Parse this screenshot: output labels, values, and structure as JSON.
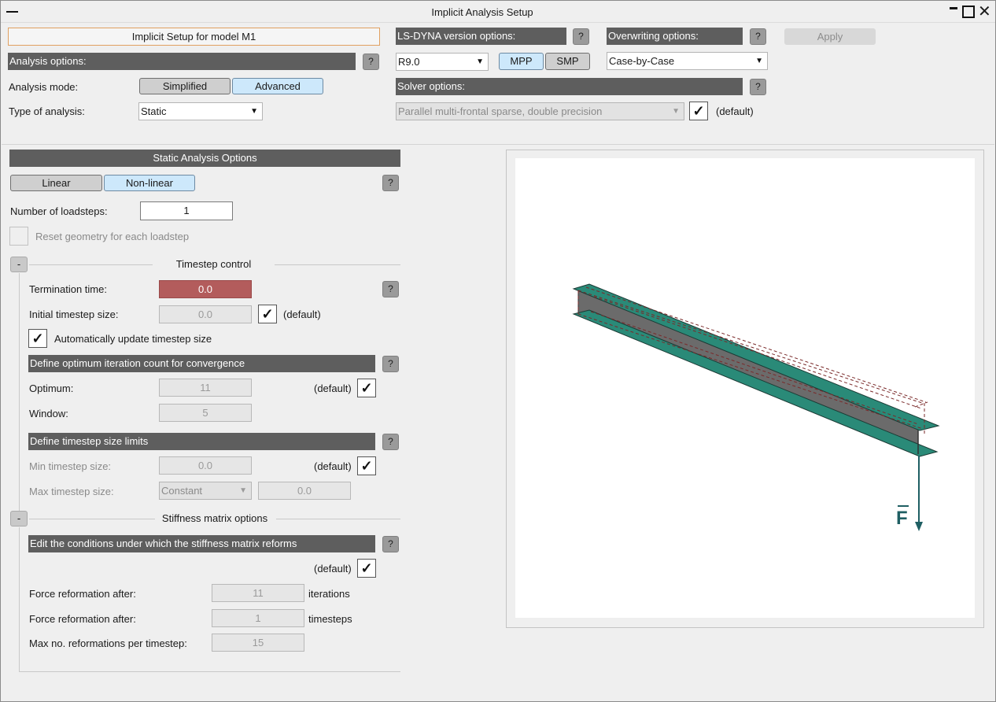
{
  "window": {
    "title": "Implicit Analysis Setup",
    "setup_title": "Implicit Setup for model M1"
  },
  "top": {
    "analysis_options_header": "Analysis options:",
    "analysis_mode_label": "Analysis mode:",
    "mode_simplified": "Simplified",
    "mode_advanced": "Advanced",
    "type_label": "Type of analysis:",
    "type_value": "Static",
    "lsdyna_header": "LS-DYNA version options:",
    "version_value": "R9.0",
    "mpp_label": "MPP",
    "smp_label": "SMP",
    "overwrite_header": "Overwriting options:",
    "overwrite_value": "Case-by-Case",
    "apply_label": "Apply",
    "solver_header": "Solver options:",
    "solver_value": "Parallel multi-frontal sparse, double precision",
    "solver_default": "(default)",
    "help_glyph": "?"
  },
  "static": {
    "header": "Static Analysis Options",
    "linear_label": "Linear",
    "nonlinear_label": "Non-linear",
    "loadsteps_label": "Number of loadsteps:",
    "loadsteps_value": "1",
    "reset_label": "Reset geometry for each loadstep"
  },
  "timestep": {
    "section_title": "Timestep control",
    "collapse_glyph": "-",
    "termination_label": "Termination time:",
    "termination_value": "0.0",
    "initial_label": "Initial timestep size:",
    "initial_value": "0.0",
    "initial_default": "(default)",
    "auto_update_label": "Automatically update timestep size",
    "iter_header": "Define optimum iteration count for convergence",
    "optimum_label": "Optimum:",
    "optimum_value": "11",
    "optimum_default": "(default)",
    "window_label": "Window:",
    "window_value": "5",
    "limits_header": "Define timestep size limits",
    "min_label": "Min timestep size:",
    "min_value": "0.0",
    "min_default": "(default)",
    "max_label": "Max timestep size:",
    "max_mode_value": "Constant",
    "max_value": "0.0"
  },
  "stiffness": {
    "section_title": "Stiffness matrix options",
    "collapse_glyph": "-",
    "reform_header": "Edit the conditions under which the stiffness matrix reforms",
    "reform_default": "(default)",
    "force_iter_label": "Force reformation after:",
    "force_iter_value": "11",
    "force_iter_unit": "iterations",
    "force_step_label": "Force reformation after:",
    "force_step_value": "1",
    "force_step_unit": "timesteps",
    "max_reform_label": "Max no. reformations per timestep:",
    "max_reform_value": "15"
  },
  "viewport": {
    "force_label": "F",
    "colors": {
      "flange": "#2a8a78",
      "web": "#6b6b6b",
      "outline": "#7a2a2a",
      "force_arrow": "#1f5f63"
    }
  },
  "glyphs": {
    "check": "✓",
    "dropdown_arrow": "▼",
    "close": "✕"
  }
}
